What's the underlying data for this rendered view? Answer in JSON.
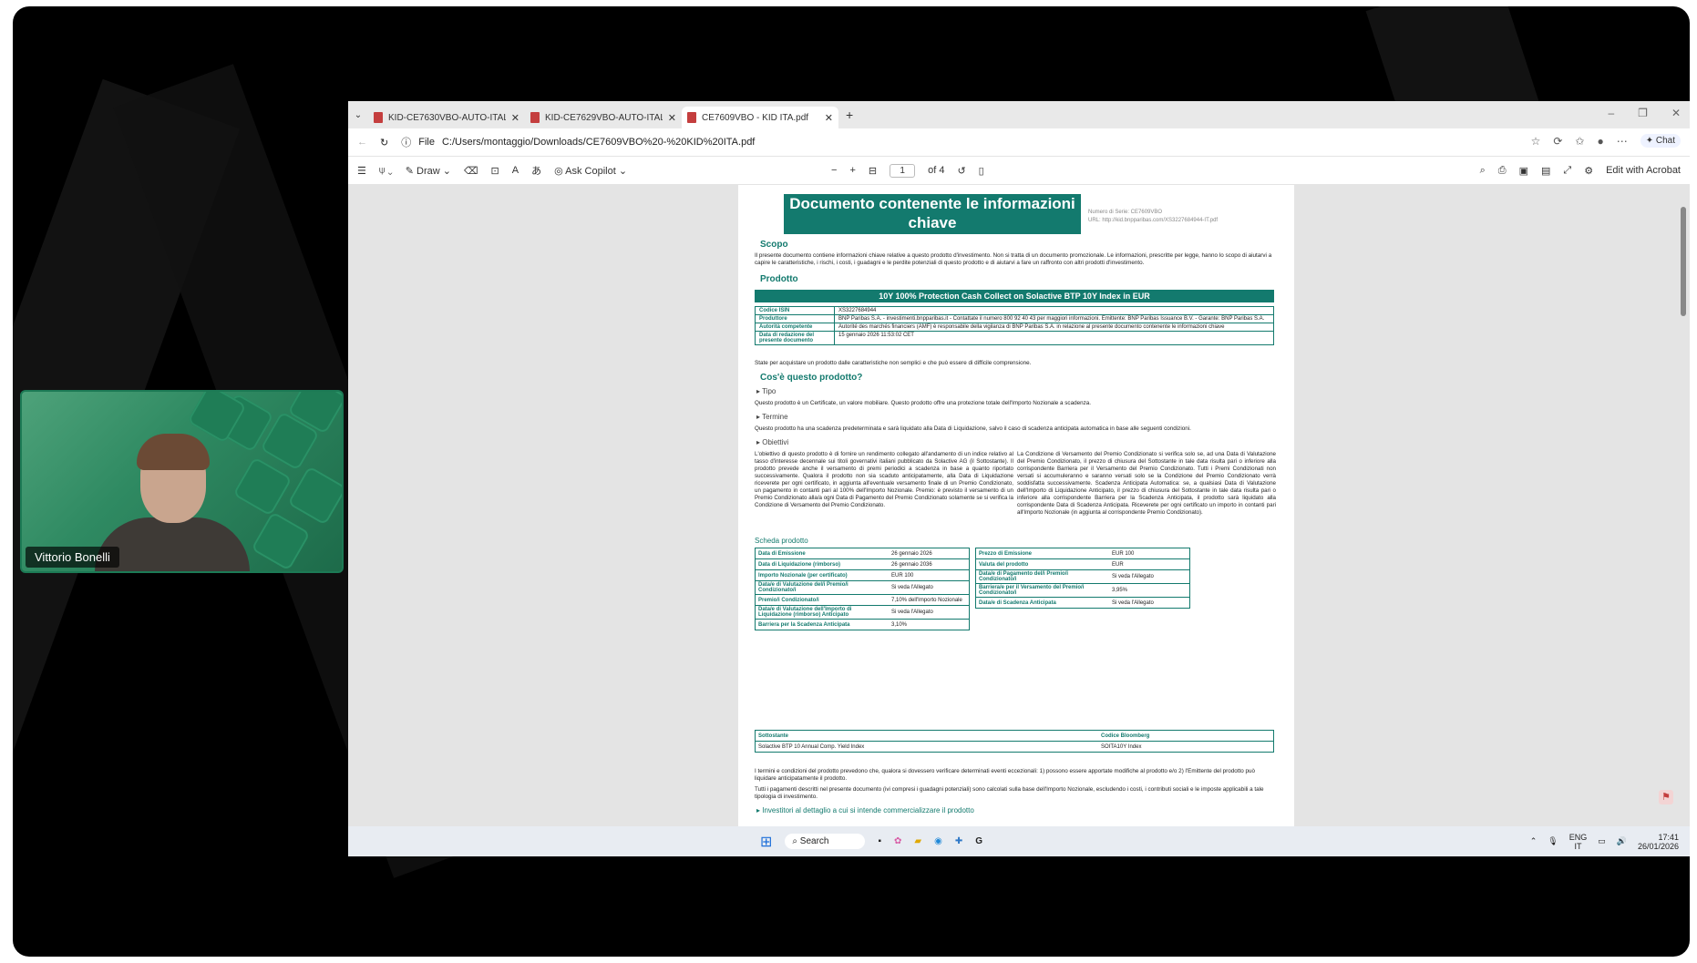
{
  "webcam": {
    "name": "Vittorio Bonelli"
  },
  "tabs": [
    {
      "label": "KID-CE7630VBO-AUTO-ITALIAN.p"
    },
    {
      "label": "KID-CE7629VBO-AUTO-ITALIAN.p"
    },
    {
      "label": "CE7609VBO - KID ITA.pdf"
    }
  ],
  "address": {
    "scheme": "File",
    "url": "C:/Users/montaggio/Downloads/CE7609VBO%20-%20KID%20ITA.pdf",
    "chat": "Chat"
  },
  "pdf_toolbar": {
    "draw": "Draw",
    "copilot": "Ask Copilot",
    "page": "1",
    "of": "of 4",
    "edit": "Edit with Acrobat"
  },
  "doc": {
    "title": "Documento contenente le informazioni chiave",
    "serial_line1": "Numero di Serie: CE7609VBO",
    "serial_line2": "URL: http://kid.bnpparibas.com/XS3227684944-IT.pdf",
    "scopo": "Scopo",
    "scopo_text": "Il presente documento contiene informazioni chiave relative a questo prodotto d'investimento. Non si tratta di un documento promozionale. Le informazioni, prescritte per legge, hanno lo scopo di aiutarvi a capire le caratteristiche, i rischi, i costi, i guadagni e le perdite potenziali di questo prodotto e di aiutarvi a fare un raffronto con altri prodotti d'investimento.",
    "prodotto": "Prodotto",
    "product_name": "10Y 100% Protection Cash Collect on Solactive BTP 10Y Index in EUR",
    "product_rows": [
      {
        "k": "Codice ISIN",
        "v": "XS3227684944"
      },
      {
        "k": "Produttore",
        "v": "BNP Paribas S.A. - investimenti.bnpparibas.it - Contattate il numero 800 92 40 43 per maggiori informazioni. Emittente: BNP Paribas Issuance B.V. - Garante: BNP Paribas S.A."
      },
      {
        "k": "Autorità competente",
        "v": "Autorité des marchés financiers (AMF) è responsabile della vigilanza di BNP Paribas S.A. in relazione al presente documento contenente le informazioni chiave"
      },
      {
        "k": "Data di redazione del presente documento",
        "v": "15 gennaio 2026 11:53:02 CET"
      }
    ],
    "warning": "State per acquistare un prodotto dalle caratteristiche non semplici e che può essere di difficile comprensione.",
    "cose": "Cos'è questo prodotto?",
    "tipo": "Tipo",
    "tipo_text": "Questo prodotto è un Certificate, un valore mobiliare. Questo prodotto offre una protezione totale dell'Importo Nozionale a scadenza.",
    "termine": "Termine",
    "termine_text": "Questo prodotto ha una scadenza predeterminata e sarà liquidato alla Data di Liquidazione, salvo il caso di scadenza anticipata automatica in base alle seguenti condizioni.",
    "obiettivi": "Obiettivi",
    "obiettivi_left": "L'obiettivo di questo prodotto è di fornire un rendimento collegato all'andamento di un indice relativo al tasso d'interesse decennale sui titoli governativi italiani pubblicato da Solactive AG (il Sottostante). Il prodotto prevede anche il versamento di premi periodici a scadenza in base a quanto riportato successivamente. Qualora il prodotto non sia scaduto anticipatamente, alla Data di Liquidazione riceverete per ogni certificato, in aggiunta all'eventuale versamento finale di un Premio Condizionato, un pagamento in contanti pari al 100% dell'Importo Nozionale. Premio: è previsto il versamento di un Premio Condizionato alla/a ogni Data di Pagamento del Premio Condizionato solamente se si verifica la Condizione di Versamento del Premio Condizionato.",
    "obiettivi_right": "La Condizione di Versamento del Premio Condizionato si verifica solo se, ad una Data di Valutazione del Premio Condizionato, il prezzo di chiusura del Sottostante in tale data risulta pari o inferiore alla corrispondente Barriera per il Versamento del Premio Condizionato. Tutti i Premi Condizionati non versati si accumuleranno e saranno versati solo se la Condizione del Premio Condizionato verrà soddisfatta successivamente. Scadenza Anticipata Automatica: se, a qualsiasi Data di Valutazione dell'Importo di Liquidazione Anticipato, il prezzo di chiusura del Sottostante in tale data risulta pari o inferiore alla corrispondente Barriera per la Scadenza Anticipata, il prodotto sarà liquidato alla corrispondente Data di Scadenza Anticipata. Riceverete per ogni certificato un importo in contanti pari all'Importo Nozionale (in aggiunta al corrispondente Premio Condizionato).",
    "scheda": "Scheda prodotto",
    "scheda_left": [
      {
        "k": "Data di Emissione",
        "v": "26 gennaio 2026"
      },
      {
        "k": "Data di Liquidazione (rimborso)",
        "v": "26 gennaio 2036"
      },
      {
        "k": "Importo Nozionale (per certificato)",
        "v": "EUR 100"
      },
      {
        "k": "Data/e di Valutazione del/i Premio/i Condizionato/i",
        "v": "Si veda l'Allegato"
      },
      {
        "k": "Premio/i Condizionato/i",
        "v": "7,10% dell'Importo Nozionale"
      },
      {
        "k": "Data/e di Valutazione dell'Importo di Liquidazione (rimborso) Anticipato",
        "v": "Si veda l'Allegato"
      },
      {
        "k": "Barriera per la Scadenza Anticipata",
        "v": "3,10%"
      }
    ],
    "scheda_right": [
      {
        "k": "Prezzo di Emissione",
        "v": "EUR 100"
      },
      {
        "k": "Valuta del prodotto",
        "v": "EUR"
      },
      {
        "k": "Data/e di Pagamento del/i Premio/i Condizionato/i",
        "v": "Si veda l'Allegato"
      },
      {
        "k": "Barriera/e per il Versamento del Premio/i Condizionato/i",
        "v": "3,95%"
      },
      {
        "k": "Data/e di Scadenza Anticipata",
        "v": "Si veda l'Allegato"
      }
    ],
    "sott_k1": "Sottostante",
    "sott_k2": "Codice Bloomberg",
    "sott_v1": "Solactive BTP 10 Annual Comp. Yield Index",
    "sott_v2": "SOITA10Y Index",
    "para1": "I termini e condizioni del prodotto prevedono che, qualora si dovessero verificare determinati eventi eccezionali: 1) possono essere apportate modifiche al prodotto e/o 2) l'Emittente del prodotto può liquidare anticipatamente il prodotto.",
    "para2": "Tutti i pagamenti descritti nel presente documento (ivi compresi i guadagni potenziali) sono calcolati sulla base dell'Importo Nozionale, escludendo i costi, i contributi sociali e le imposte applicabili a tale tipologia di investimento.",
    "investitori": "Investitori al dettaglio a cui si intende commercializzare il prodotto"
  },
  "taskbar": {
    "search": "Search",
    "lang1": "ENG",
    "lang2": "IT",
    "time": "17:41",
    "date": "26/01/2026"
  }
}
